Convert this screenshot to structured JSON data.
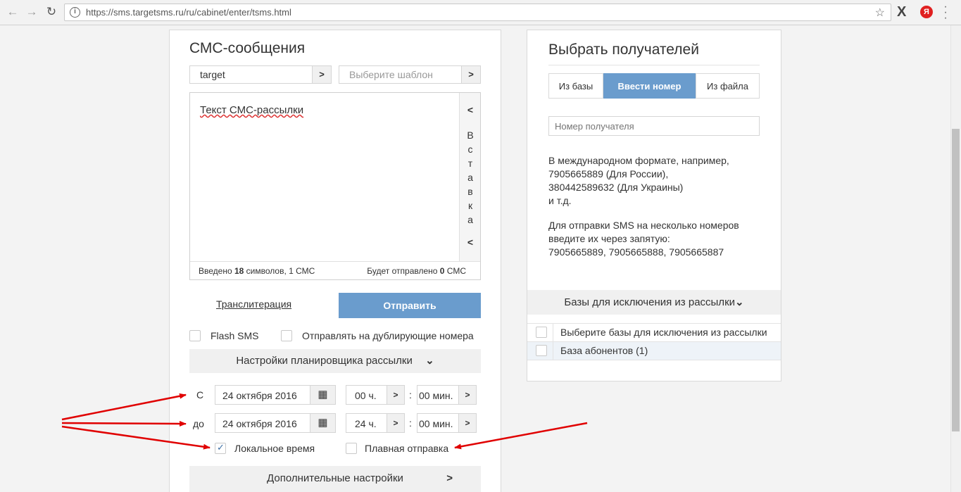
{
  "browser": {
    "url": "https://sms.targetsms.ru/ru/cabinet/enter/tsms.html",
    "ext_x": "X",
    "ext_y": "Я"
  },
  "sms": {
    "title": "СМС-сообщения",
    "sender": "target",
    "template_placeholder": "Выберите шаблон",
    "message_text": "Текст СМС-рассылки",
    "insert_label": "Вставка",
    "insert_letters": [
      "В",
      "с",
      "т",
      "а",
      "в",
      "к",
      "а"
    ],
    "counter_prefix": "Введено ",
    "counter_count": "18",
    "counter_middle": " символов, 1 СМС",
    "send_prefix": "Будет отправлено ",
    "send_count": "0",
    "send_suffix": " СМС",
    "translit_label": "Транслитерация",
    "send_button": "Отправить",
    "flash_label": "Flash SMS",
    "duplicate_label": "Отправлять на дублирующие номера",
    "scheduler_label": "Настройки планировщика рассылки",
    "from_label": "С",
    "to_label": "до",
    "from_date": "24 октября 2016",
    "from_hour": "00 ч.",
    "from_min": "00 мин.",
    "to_date": "24 октября 2016",
    "to_hour": "24 ч.",
    "to_min": "00 мин.",
    "colon": ":",
    "local_time_label": "Локальное время",
    "local_time_checked": true,
    "smooth_label": "Плавная отправка",
    "smooth_checked": false,
    "extra_settings_label": "Дополнительные настройки"
  },
  "recipients": {
    "title": "Выбрать получателей",
    "tabs": [
      {
        "label": "Из базы",
        "active": false
      },
      {
        "label": "Ввести номер",
        "active": true
      },
      {
        "label": "Из файла",
        "active": false
      }
    ],
    "number_placeholder": "Номер получателя",
    "help1": "В международном формате, например,\n7905665889 (Для России),\n380442589632 (Для Украины)\nи т.д.",
    "help2": "Для отправки SMS на несколько номеров\nвведите их через запятую:\n7905665889, 7905665888, 7905665887",
    "exclusion_label": "Базы для исключения из рассылки",
    "exclusion_rows": [
      {
        "label": "Выберите базы для исключения из рассылки",
        "checked": false
      },
      {
        "label": "База абонентов (1)",
        "checked": false
      }
    ]
  },
  "colors": {
    "accent": "#6a9ccd",
    "arrow": "#e00000"
  }
}
